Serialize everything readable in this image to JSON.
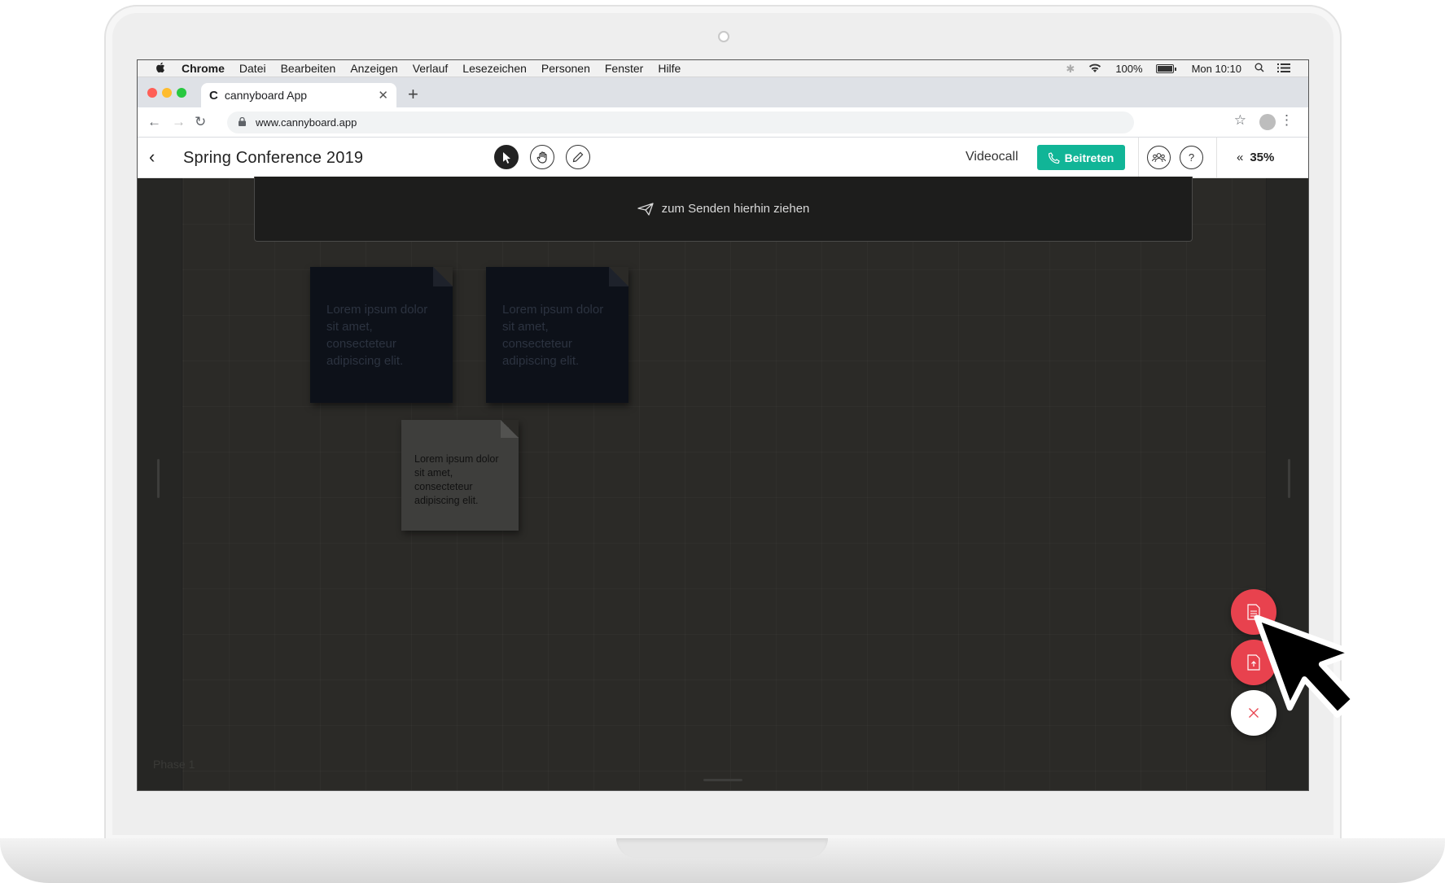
{
  "menubar": {
    "apple": "",
    "items": [
      "Chrome",
      "Datei",
      "Bearbeiten",
      "Anzeigen",
      "Verlauf",
      "Lesezeichen",
      "Personen",
      "Fenster",
      "Hilfe"
    ],
    "battery": "100%",
    "clock": "Mon 10:10"
  },
  "browser": {
    "tab_title": "cannyboard App",
    "favicon": "C",
    "url": "www.cannyboard.app",
    "traffic_colors": [
      "#ff5f57",
      "#febc2e",
      "#28c840"
    ]
  },
  "app": {
    "board_title": "Spring Conference 2019",
    "videocall_label": "Videocall",
    "join_label": "Beitreten",
    "help_label": "?",
    "zoom": "35%",
    "accent_green": "#11b597",
    "accent_red": "#e8424e"
  },
  "board": {
    "dropzone_text": "zum Senden hierhin ziehen",
    "phase_label": "Phase 1",
    "stickies": [
      {
        "text": "Lorem ipsum dolor sit amet, consecteteur adipiscing elit."
      },
      {
        "text": "Lorem ipsum dolor sit amet, consecteteur adipiscing elit."
      }
    ],
    "light_sticky": {
      "text": "Lorem ipsum dolor sit amet, consecteteur adipiscing elit."
    }
  },
  "icons": {
    "back": "chevron-left-icon",
    "tools": [
      "pointer-icon",
      "hand-icon",
      "pen-icon"
    ],
    "fabs": [
      "document-icon",
      "upload-icon",
      "close-icon"
    ]
  }
}
